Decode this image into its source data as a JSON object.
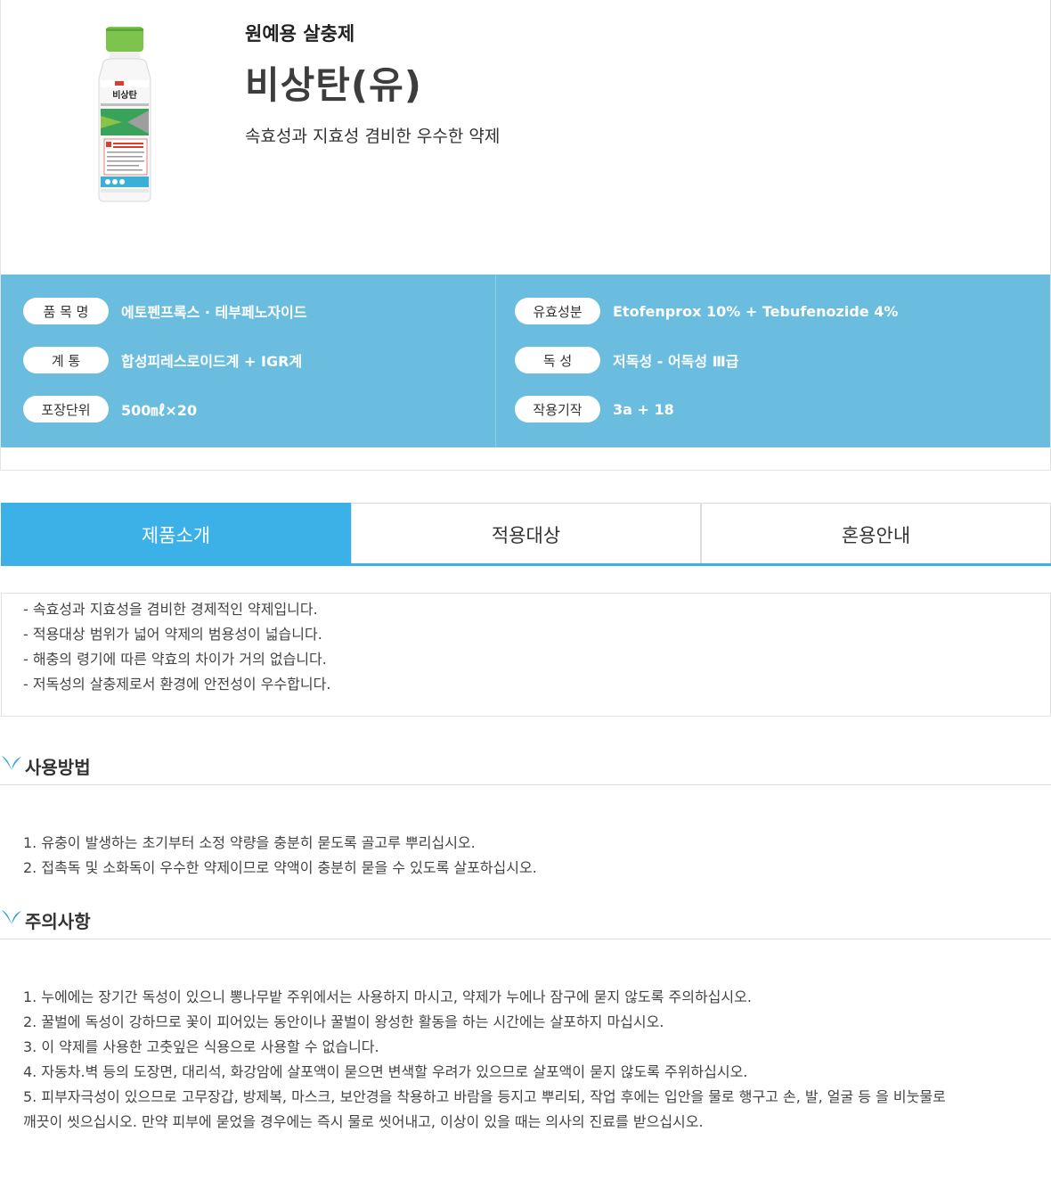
{
  "product": {
    "category": "원예용 살충제",
    "name": "비상탄(유)",
    "tagline": "속효성과 지효성 겸비한 우수한 약제",
    "image_label": "비상탄"
  },
  "specs": {
    "left": [
      {
        "label": "품 목 명",
        "value": "에토펜프록스 · 테부페노자이드"
      },
      {
        "label": "계 통",
        "value": "합성피레스로이드계 + IGR계"
      },
      {
        "label": "포장단위",
        "value": "500㎖×20"
      }
    ],
    "right": [
      {
        "label": "유효성분",
        "value": "Etofenprox 10% + Tebufenozide 4%"
      },
      {
        "label": "독 성",
        "value": "저독성 - 어독성 Ⅲ급"
      },
      {
        "label": "작용기작",
        "value": "3a + 18"
      }
    ]
  },
  "tabs": [
    {
      "label": "제품소개",
      "active": true
    },
    {
      "label": "적용대상",
      "active": false
    },
    {
      "label": "혼용안내",
      "active": false
    }
  ],
  "intro": [
    "- 속효성과 지효성을 겸비한 경제적인 약제입니다.",
    "- 적용대상 범위가 넓어 약제의 범용성이 넓습니다.",
    "- 해충의 령기에 따른 약효의 차이가 거의 없습니다.",
    "- 저독성의 살충제로서 환경에 안전성이 우수합니다."
  ],
  "usage": {
    "title": "사용방법",
    "items": [
      "1. 유충이 발생하는 초기부터 소정 약량을 충분히 묻도록 골고루 뿌리십시오.",
      "2. 접촉독 및 소화독이 우수한 약제이므로 약액이 충분히 묻을 수 있도록 살포하십시오."
    ]
  },
  "caution": {
    "title": "주의사항",
    "items": [
      "1. 누에에는 장기간 독성이 있으니 뽕나무밭 주위에서는 사용하지 마시고, 약제가 누에나 잠구에 묻지 않도록 주의하십시오.",
      "2. 꿀벌에 독성이 강하므로 꽃이 피어있는 동안이나 꿀벌이 왕성한 활동을 하는 시간에는 살포하지 마십시오.",
      "3. 이 약제를 사용한 고춧잎은 식용으로 사용할 수 없습니다.",
      "4. 자동차.벽 등의 도장면, 대리석, 화강암에 살포액이 묻으면 변색할 우려가 있으므로 살포액이 묻지 않도록 주위하십시오.",
      "5. 피부자극성이 있으므로 고무장갑, 방제복, 마스크, 보안경을 착용하고 바람을 등지고 뿌리되, 작업 후에는 입안을 물로 행구고 손, 발, 얼굴 등 을 비눗물로",
      "깨끗이 씻으십시오. 만약 피부에 묻었을 경우에는 즉시 물로 씻어내고, 이상이 있을 때는 의사의 진료를 받으십시오."
    ]
  },
  "colors": {
    "spec_bg": "#6bbddf",
    "tab_active": "#3bb1e8",
    "leaf_icon": "#2aa3d8"
  }
}
